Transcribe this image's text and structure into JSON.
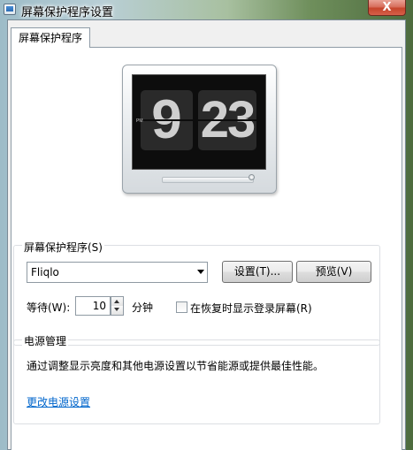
{
  "window": {
    "title": "屏幕保护程序设置",
    "close_label": "X"
  },
  "tab": {
    "label": "屏幕保护程序"
  },
  "preview": {
    "hour": "9",
    "minute": "23",
    "ampm": "PM"
  },
  "screensaver": {
    "group_label": "屏幕保护程序(S)",
    "selected": "Fliqlo",
    "settings_button": "设置(T)...",
    "preview_button": "预览(V)",
    "wait_label": "等待(W):",
    "wait_value": "10",
    "minutes_label": "分钟",
    "resume_checkbox_label": "在恢复时显示登录屏幕(R)",
    "resume_checked": false
  },
  "power": {
    "group_label": "电源管理",
    "description": "通过调整显示亮度和其他电源设置以节省能源或提供最佳性能。",
    "link": "更改电源设置"
  },
  "colors": {
    "link": "#0066cc",
    "close_button": "#c6452c"
  }
}
